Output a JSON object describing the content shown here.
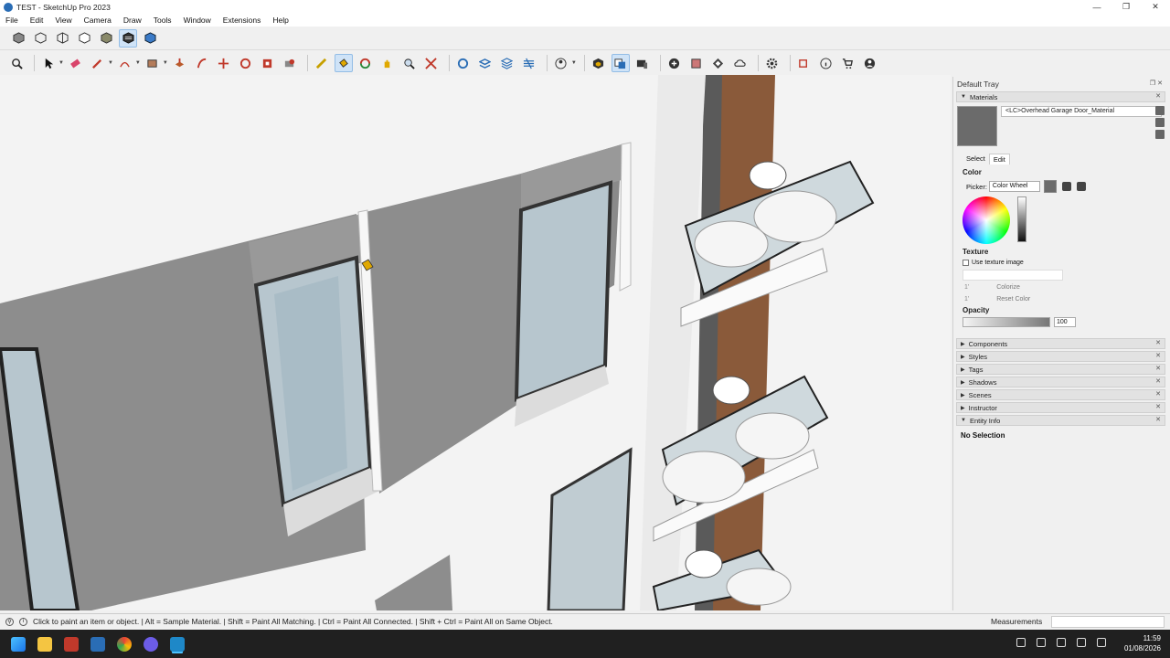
{
  "window": {
    "title": "TEST - SketchUp Pro 2023",
    "controls": [
      "—",
      "❐",
      "✕"
    ]
  },
  "menu": [
    "File",
    "Edit",
    "View",
    "Camera",
    "Draw",
    "Tools",
    "Window",
    "Extensions",
    "Help"
  ],
  "tray": {
    "title": "Default Tray",
    "materials": {
      "header": "Materials",
      "material_name": "<LC>Overhead Garage Door_Material",
      "tab_select": "Select",
      "tab_edit": "Edit",
      "color_label": "Color",
      "picker_label": "Picker:",
      "picker_value": "Color Wheel",
      "texture_label": "Texture",
      "use_texture": "Use texture image",
      "width": "1'",
      "height": "1'",
      "colorize": "Colorize",
      "reset_color": "Reset Color",
      "opacity_label": "Opacity",
      "opacity_value": "100"
    },
    "panels": [
      "Components",
      "Styles",
      "Tags",
      "Shadows",
      "Scenes",
      "Instructor",
      "Entity Info"
    ],
    "entity_info": "No Selection"
  },
  "status": {
    "text": "Click to paint an item or object. | Alt = Sample Material. | Shift = Paint All Matching. | Ctrl = Paint All Connected. | Shift + Ctrl = Paint All on Same Object.",
    "measurements_label": "Measurements"
  },
  "clock": {
    "time": "11:59",
    "date": "01/08/2026"
  },
  "colors": {
    "accent": "#2a6db5",
    "taskbar": "#202020",
    "swatch": "#6b6b6b"
  }
}
